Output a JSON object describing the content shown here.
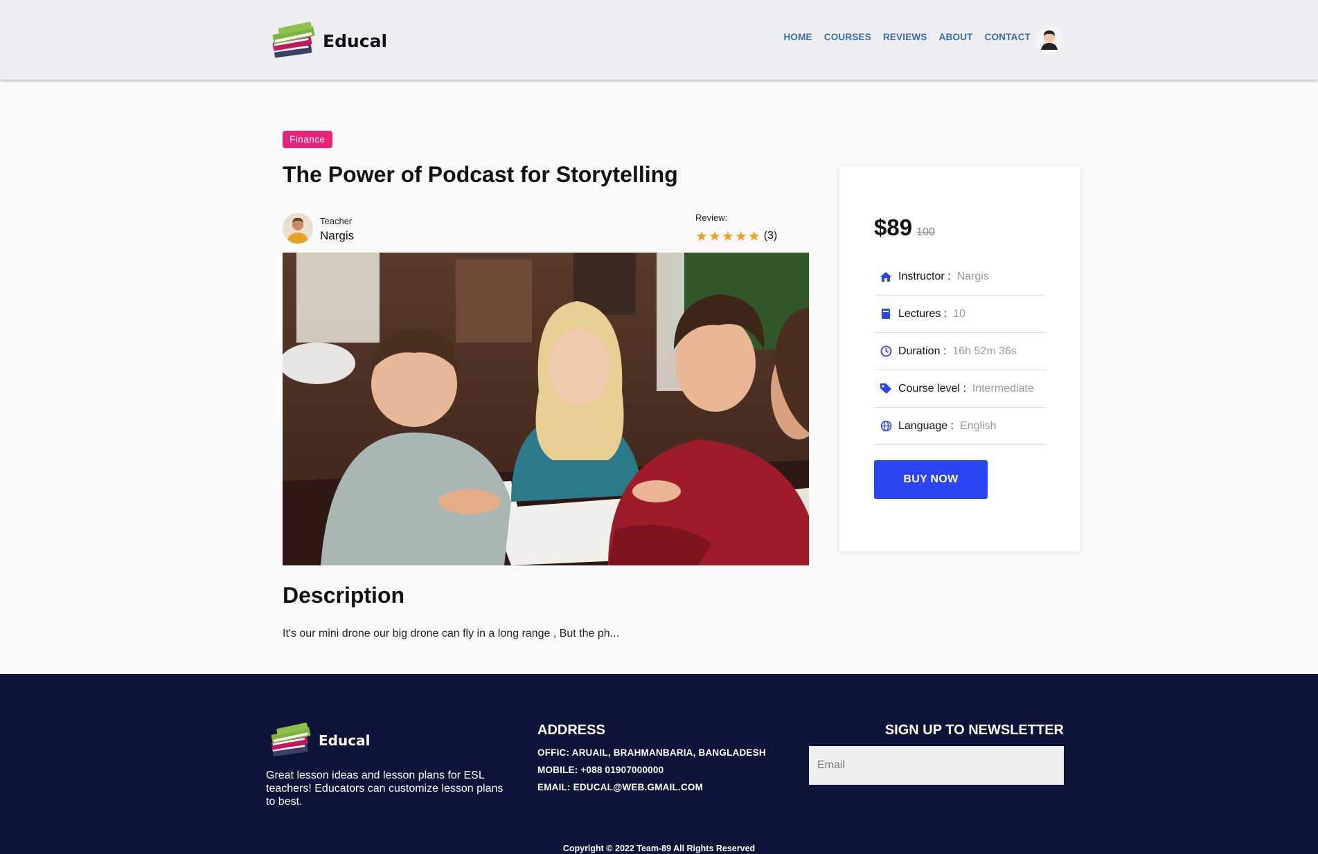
{
  "brand": {
    "name": "Educal"
  },
  "nav": {
    "items": [
      "HOME",
      "COURSES",
      "REVIEWS",
      "ABOUT",
      "CONTACT"
    ]
  },
  "course": {
    "category": "Finance",
    "title": "The Power of Podcast for Storytelling",
    "teacher_label": "Teacher",
    "teacher_name": "Nargis",
    "review_label": "Review:",
    "rating": 5,
    "review_count": "(3)",
    "description_heading": "Description",
    "description": "It's our mini drone our big drone can fly in a long range , But the ph..."
  },
  "sidebar": {
    "price": "$89",
    "old_price": "100",
    "info": [
      {
        "icon": "home-icon",
        "key": "Instructor :",
        "value": "Nargis"
      },
      {
        "icon": "book-icon",
        "key": "Lectures :",
        "value": "10"
      },
      {
        "icon": "clock-icon",
        "key": "Duration :",
        "value": "16h 52m 36s"
      },
      {
        "icon": "tag-icon",
        "key": "Course level :",
        "value": "Intermediate"
      },
      {
        "icon": "globe-icon",
        "key": "Language :",
        "value": "English"
      }
    ],
    "buy_label": "BUY NOW"
  },
  "footer": {
    "brand": "Educal",
    "about": "Great lesson ideas and lesson plans for ESL teachers! Educators can customize lesson plans to best.",
    "address_heading": "ADDRESS",
    "office": "OFFIC: ARUAIL, BRAHMANBARIA, BANGLADESH",
    "mobile": "MOBILE: +088 01907000000",
    "email": "EMAIL: EDUCAL@WEB.GMAIL.COM",
    "newsletter_heading": "SIGN UP TO NEWSLETTER",
    "email_placeholder": "Email",
    "copyright": "Copyright © 2022 Team-89 All Rights Reserved"
  },
  "colors": {
    "accent": "#2b45f5",
    "badge": "#e9237a",
    "footer_bg": "#0e1339",
    "nav_link": "#3d6aa8",
    "star": "#f4a11d"
  }
}
